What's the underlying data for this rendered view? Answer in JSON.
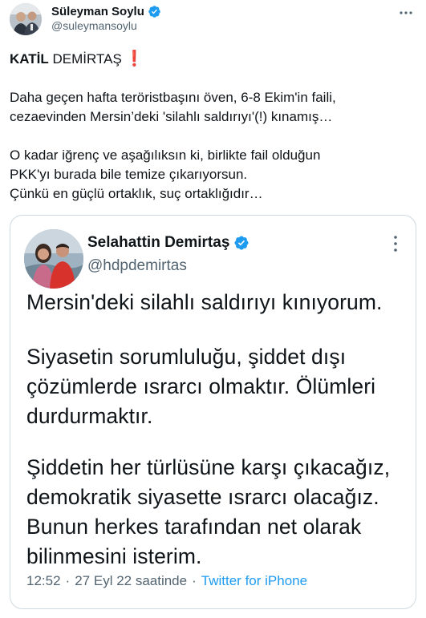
{
  "author": {
    "display_name": "Süleyman Soylu",
    "handle": "@suleymansoylu",
    "verified": true
  },
  "tweet": {
    "headline_bold": "KATİL",
    "headline_rest": " DEMİRTAŞ",
    "headline_emoji": "❗",
    "paragraph_2": [
      "Daha geçen hafta teröristbaşını öven, 6-8 Ekim'in faili,",
      "cezaevinden Mersin’deki 'silahlı saldırıyı'(!) kınamış…"
    ],
    "paragraph_3": [
      "O kadar iğrenç ve aşağılıksın ki, birlikte fail olduğun",
      "PKK'yı burada bile temize çıkarıyorsun.",
      "Çünkü en güçlü ortaklık, suç ortaklığıdır…"
    ]
  },
  "quoted": {
    "display_name": "Selahattin Demirtaş",
    "handle": "@hdpdemirtas",
    "verified": true,
    "paragraph_1": [
      "Mersin'deki silahlı saldırıyı kınıyorum."
    ],
    "paragraph_2": [
      "Siyasetin sorumluluğu, şiddet dışı",
      "çözümlerde ısrarcı olmaktır. Ölümleri",
      "durdurmaktır."
    ],
    "paragraph_3": [
      "Şiddetin her türlüsüne karşı çıkacağız,",
      "demokratik siyasette ısrarcı olacağız.",
      "Bunun herkes tarafından net olarak",
      "bilinmesini isterim."
    ],
    "time": "12:52",
    "separator": "·",
    "date": "27 Eyl 22 saatinde",
    "source": "Twitter for iPhone"
  },
  "colors": {
    "verified_blue": "#1d9bf0",
    "secondary_text": "#536471",
    "border": "#cfd9de",
    "emoji_red": "#d81f3c"
  },
  "icons": {
    "verified": "verified-badge-icon",
    "more": "more-options-icon"
  }
}
